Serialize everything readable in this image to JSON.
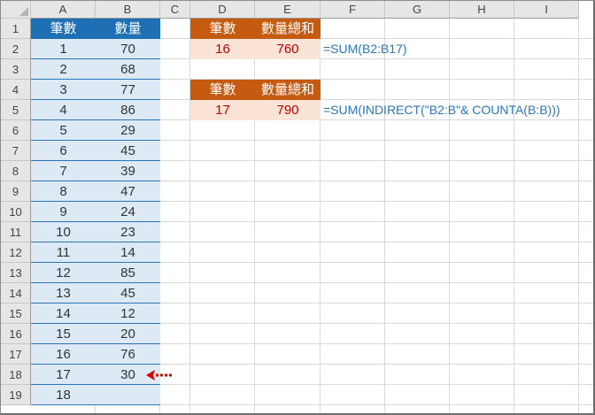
{
  "columns": [
    "A",
    "B",
    "C",
    "D",
    "E",
    "F",
    "G",
    "H",
    "I"
  ],
  "rows": [
    "1",
    "2",
    "3",
    "4",
    "5",
    "6",
    "7",
    "8",
    "9",
    "10",
    "11",
    "12",
    "13",
    "14",
    "15",
    "16",
    "17",
    "18",
    "19"
  ],
  "table_left": {
    "header_count": "筆數",
    "header_qty": "數量",
    "data": [
      [
        "1",
        "70"
      ],
      [
        "2",
        "68"
      ],
      [
        "3",
        "77"
      ],
      [
        "4",
        "86"
      ],
      [
        "5",
        "29"
      ],
      [
        "6",
        "45"
      ],
      [
        "7",
        "39"
      ],
      [
        "8",
        "47"
      ],
      [
        "9",
        "24"
      ],
      [
        "10",
        "23"
      ],
      [
        "11",
        "14"
      ],
      [
        "12",
        "85"
      ],
      [
        "13",
        "45"
      ],
      [
        "14",
        "12"
      ],
      [
        "15",
        "20"
      ],
      [
        "16",
        "76"
      ],
      [
        "17",
        "30"
      ],
      [
        "18",
        ""
      ]
    ]
  },
  "summary1": {
    "header_count": "筆數",
    "header_total": "數量總和",
    "count": "16",
    "total": "760",
    "formula": "=SUM(B2:B17)"
  },
  "summary2": {
    "header_count": "筆數",
    "header_total": "數量總和",
    "count": "17",
    "total": "790",
    "formula": "=SUM(INDIRECT(\"B2:B\"& COUNTA(B:B)))"
  },
  "colors": {
    "header_blue": "#1f6fb5",
    "data_blue": "#dde9f5",
    "header_brown": "#c55a11",
    "data_peach": "#fbe4d5",
    "value_red": "#c00000",
    "formula_blue": "#2e75b6",
    "arrow_red": "#d40000"
  },
  "icons": {
    "row18_pointer": "red-dotted-left-arrow"
  }
}
